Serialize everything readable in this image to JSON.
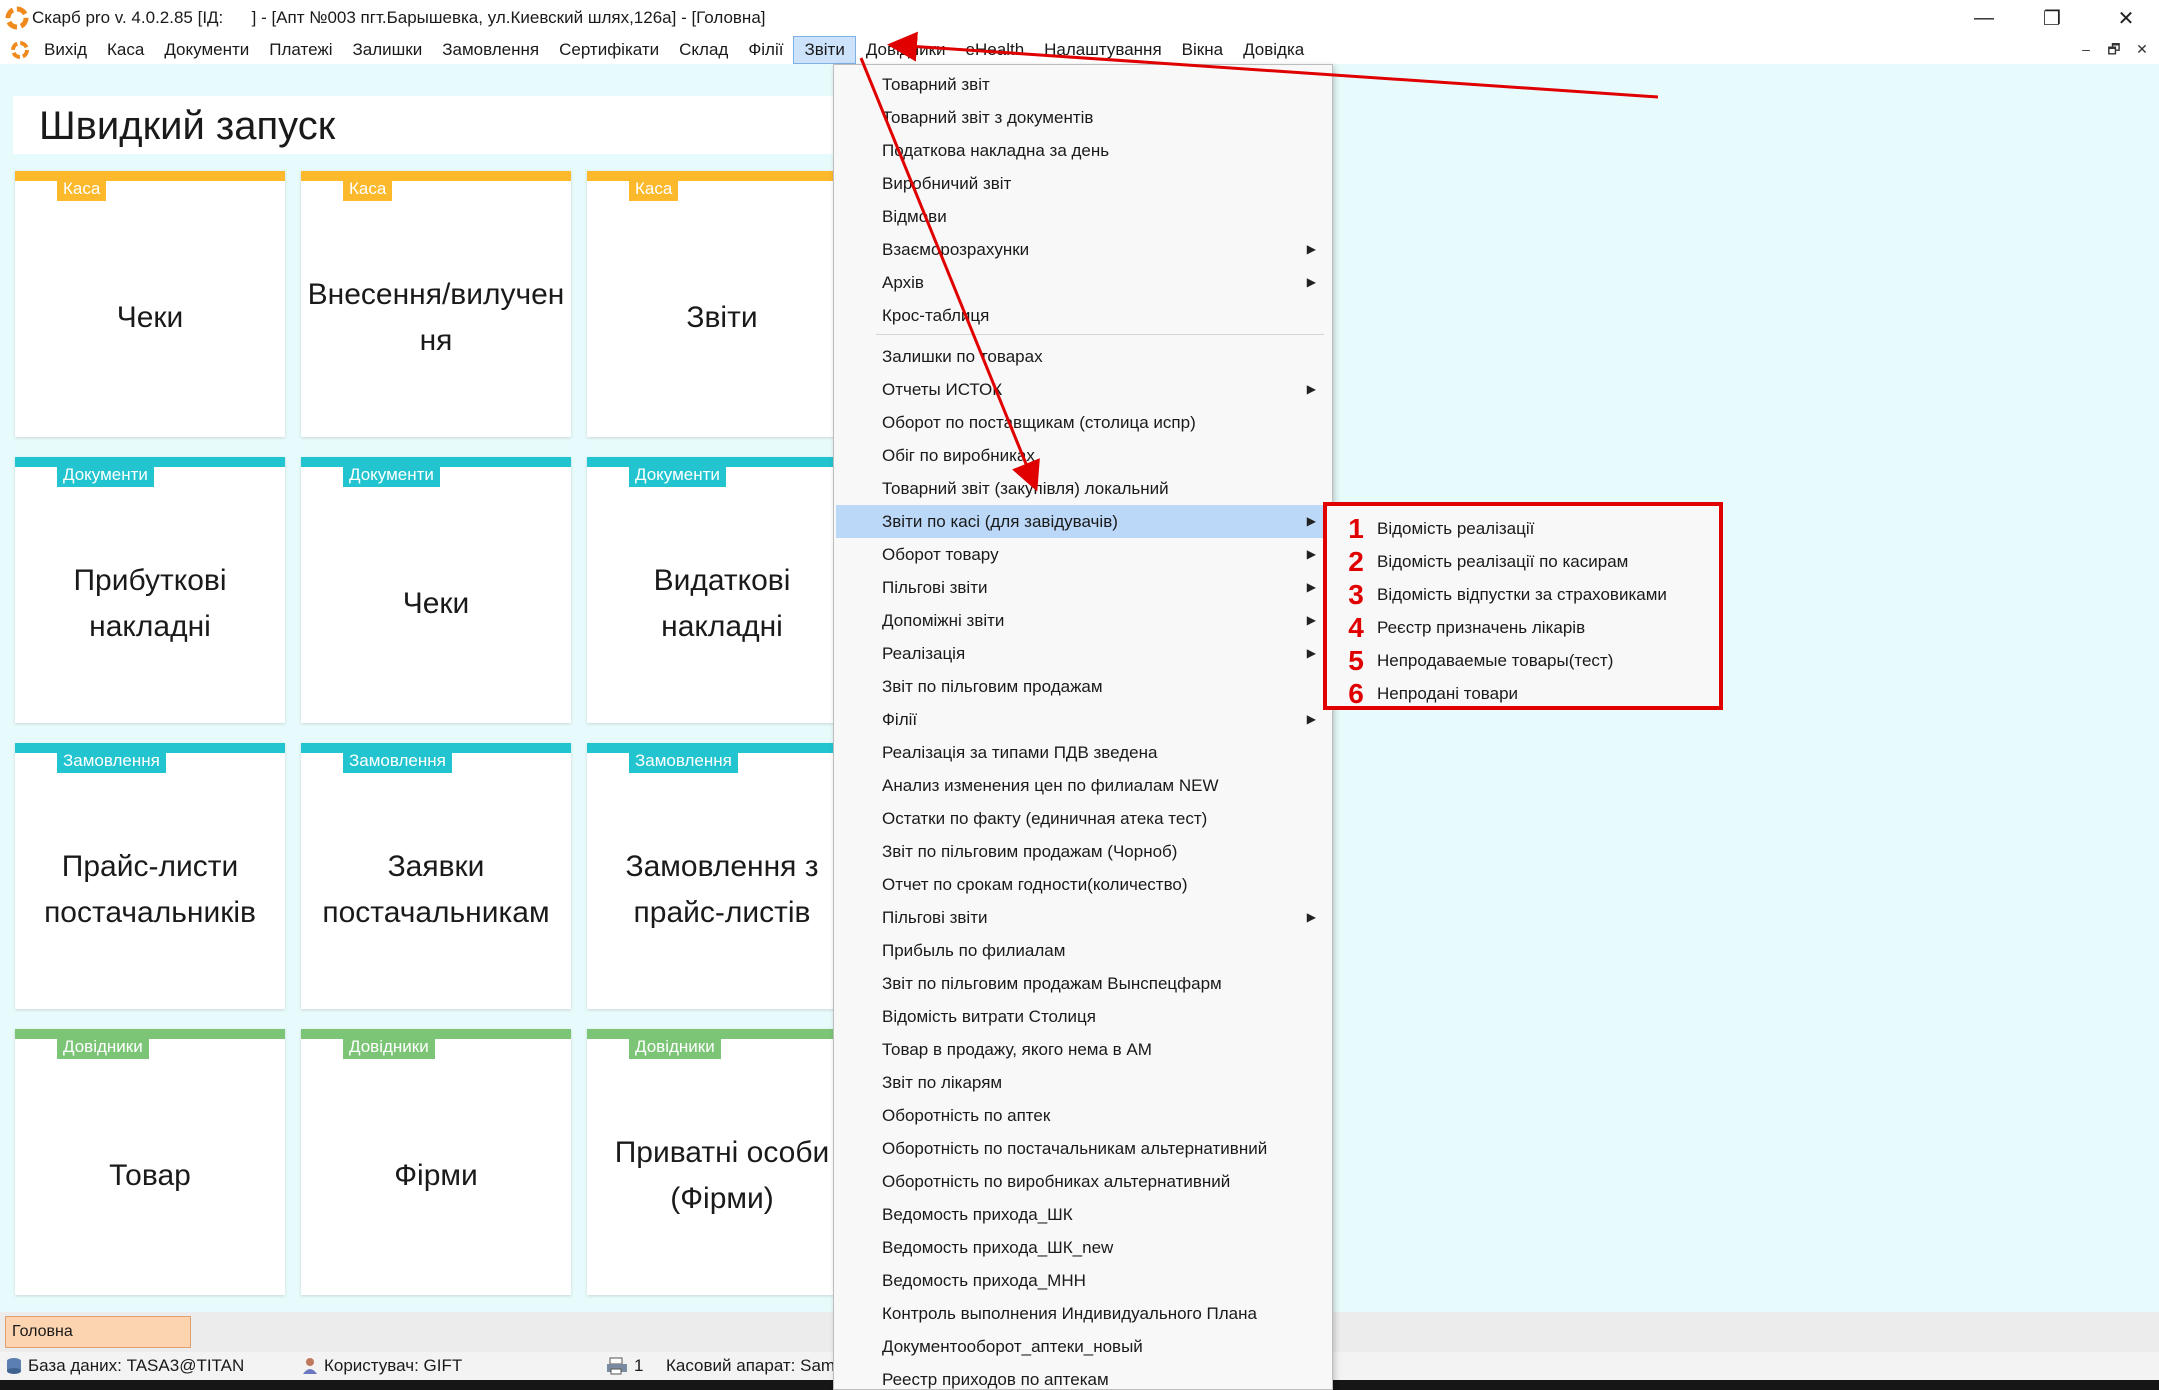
{
  "window": {
    "title": "Скарб pro v. 4.0.2.85 [ІД:      ] - [Апт №003 пгт.Барышевка, ул.Киевский шлях,126а] - [Головна]",
    "minimize_glyph": "—",
    "restore_glyph": "❐",
    "close_glyph": "✕"
  },
  "menubar": {
    "items": [
      "Вихід",
      "Каса",
      "Документи",
      "Платежі",
      "Залишки",
      "Замовлення",
      "Сертифікати",
      "Склад",
      "Філії",
      "Звіти",
      "Довідники",
      "eHealth",
      "Налаштування",
      "Вікна",
      "Довідка"
    ],
    "active": "Звіти",
    "mdi": {
      "minimize": "–",
      "restore": "🗗",
      "close": "✕"
    }
  },
  "quick_launch": {
    "title": "Швидкий запуск",
    "tiles": [
      {
        "tag": "Каса",
        "label": "Чеки",
        "color": "#fbb92b"
      },
      {
        "tag": "Каса",
        "label": "Внесення/вилучен ня",
        "color": "#fbb92b"
      },
      {
        "tag": "Каса",
        "label": "Звіти",
        "color": "#fbb92b"
      },
      {
        "tag": "Документи",
        "label": "Прибуткові накладні",
        "color": "#22c4d0"
      },
      {
        "tag": "Документи",
        "label": "Чеки",
        "color": "#22c4d0"
      },
      {
        "tag": "Документи",
        "label": "Видаткові накладні",
        "color": "#22c4d0"
      },
      {
        "tag": "Замовлення",
        "label": "Прайс-листи постачальників",
        "color": "#22c4d0"
      },
      {
        "tag": "Замовлення",
        "label": "Заявки постачальникам",
        "color": "#22c4d0"
      },
      {
        "tag": "Замовлення",
        "label": "Замовлення з прайс-листів",
        "color": "#22c4d0"
      },
      {
        "tag": "Довідники",
        "label": "Товар",
        "color": "#7cc576"
      },
      {
        "tag": "Довідники",
        "label": "Фірми",
        "color": "#7cc576"
      },
      {
        "tag": "Довідники",
        "label": "Приватні особи (Фірми)",
        "color": "#7cc576"
      }
    ]
  },
  "dropdown": {
    "items": [
      {
        "label": "Товарний звіт",
        "sub": false
      },
      {
        "label": "Товарний звіт з документів",
        "sub": false
      },
      {
        "label": "Податкова накладна за день",
        "sub": false
      },
      {
        "label": "Виробничий звіт",
        "sub": false
      },
      {
        "label": "Відмови",
        "sub": false
      },
      {
        "label": "Взаєморозрахунки",
        "sub": true
      },
      {
        "label": "Архів",
        "sub": true
      },
      {
        "label": "Крос-таблиця",
        "sub": false
      },
      {
        "label": "Залишки по товарах",
        "sub": false
      },
      {
        "label": "Отчеты ИСТОК",
        "sub": true
      },
      {
        "label": "Оборот по поставщикам (столица испр)",
        "sub": false
      },
      {
        "label": "Обіг по виробниках",
        "sub": false
      },
      {
        "label": "Товарний звіт (закупівля) локальний",
        "sub": false
      },
      {
        "label": "Звіти по касі (для завідувачів)",
        "sub": true
      },
      {
        "label": "Оборот товару",
        "sub": true
      },
      {
        "label": "Пільгові звіти",
        "sub": true
      },
      {
        "label": "Допоміжні звіти",
        "sub": true
      },
      {
        "label": "Реалізація",
        "sub": true
      },
      {
        "label": "Звіт по пільговим продажам",
        "sub": false
      },
      {
        "label": "Філії",
        "sub": true
      },
      {
        "label": "Реалізація за типами ПДВ зведена",
        "sub": false
      },
      {
        "label": "Анализ изменения цен по филиалам NEW",
        "sub": false
      },
      {
        "label": "Остатки по факту (единичная атека тест)",
        "sub": false
      },
      {
        "label": "Звіт по пільговим продажам (Чорноб)",
        "sub": false
      },
      {
        "label": "Отчет по срокам годности(количество)",
        "sub": false
      },
      {
        "label": "Пільгові звіти",
        "sub": true
      },
      {
        "label": "Прибыль по филиалам",
        "sub": false
      },
      {
        "label": "Звіт по пільговим продажам Вынспецфарм",
        "sub": false
      },
      {
        "label": "Відомість витрати Столиця",
        "sub": false
      },
      {
        "label": "Товар в продажу, якого нема в АМ",
        "sub": false
      },
      {
        "label": "Звіт по лікарям",
        "sub": false
      },
      {
        "label": "Оборотність по аптек",
        "sub": false
      },
      {
        "label": "Оборотність по постачальникам альтернативний",
        "sub": false
      },
      {
        "label": "Оборотність по виробниках альтернативний",
        "sub": false
      },
      {
        "label": "Ведомость прихода_ШК",
        "sub": false
      },
      {
        "label": "Ведомость прихода_ШК_new",
        "sub": false
      },
      {
        "label": "Ведомость прихода_МНН",
        "sub": false
      },
      {
        "label": "Контроль выполнения Индивидуального Плана",
        "sub": false
      },
      {
        "label": "Документооборот_аптеки_новый",
        "sub": false
      },
      {
        "label": "Реестр приходов по аптекам",
        "sub": false
      }
    ],
    "highlighted": "Звіти по касі (для завідувачів)",
    "submenu_arrow": "▶"
  },
  "submenu": {
    "items": [
      {
        "num": "1",
        "label": "Відомість реалізації"
      },
      {
        "num": "2",
        "label": "Відомість реалізації по касирам"
      },
      {
        "num": "3",
        "label": "Відомість відпустки за страховиками"
      },
      {
        "num": "4",
        "label": "Реєстр призначень лікарів"
      },
      {
        "num": "5",
        "label": "Непродаваемые товары(тест)"
      },
      {
        "num": "6",
        "label": "Непродані товари"
      }
    ]
  },
  "tabbar": {
    "active_tab": "Головна"
  },
  "statusbar": {
    "database": "База даних: TASA3@TITAN",
    "user": "Користувач: GIFT",
    "count": "1",
    "cash_register": "Касовий апарат: Sam"
  },
  "colors": {
    "annotation": "#e00000",
    "workspace": "#e8fbfc",
    "kasa": "#fbb92b",
    "documents": "#22c4d0",
    "dictionaries": "#7cc576"
  }
}
